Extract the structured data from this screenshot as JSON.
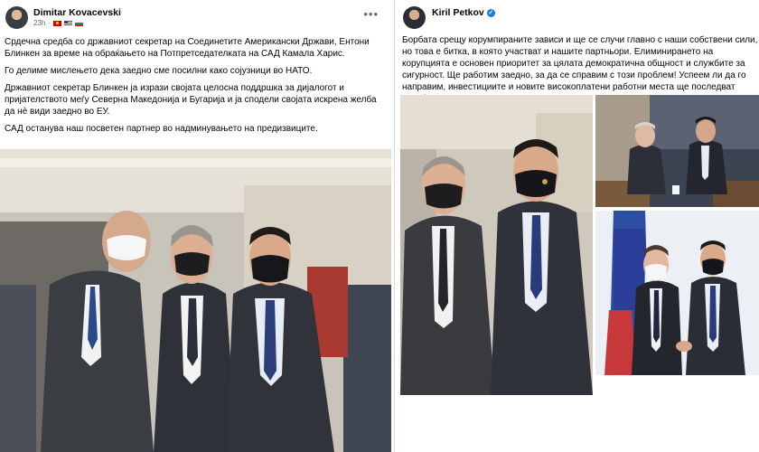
{
  "left_post": {
    "author": "Dimitar Kovacevski",
    "time": "23h",
    "more_icon": "more-options-icon",
    "paragraphs": [
      "Срдечна средба со државниот секретар на Соединетите Американски Држави, Ентони Блинкен за време на обраќањето на Потпретседателката на САД Камала Харис.",
      "Го делиме мислењето дека заедно сме посилни како сојузници во НАТО.",
      "Државниот секретар Блинкен ја изрази својата целосна поддршка за дијалогот и пријателството меѓу Северна Македонија и Бугарија и ја сподели својата искрена желба да нè види заедно во ЕУ.",
      "САД останува наш посветен партнер во надминувањето на предизвиците."
    ]
  },
  "right_post": {
    "author": "Kiril Petkov",
    "verified_icon": "verified-badge-icon",
    "more_icon": "more-options-icon",
    "text": "Борбата срещу корумпираните зависи и ще се случи главно с наши собствени сили, но това е битка, в която участват и нашите партньори.  Елиминирането на корупцията е основен приоритет за цялата демократична общност и службите за сигурност.  Ще работим заедно, за да се справим с този проблем!  Успеем ли да го направим, инвестициите и новите високоплатени работни места ще последват незабавно!"
  },
  "colors": {
    "link_blue": "#1877f2",
    "meta_gray": "#65676b",
    "divider": "#d6d9de"
  }
}
